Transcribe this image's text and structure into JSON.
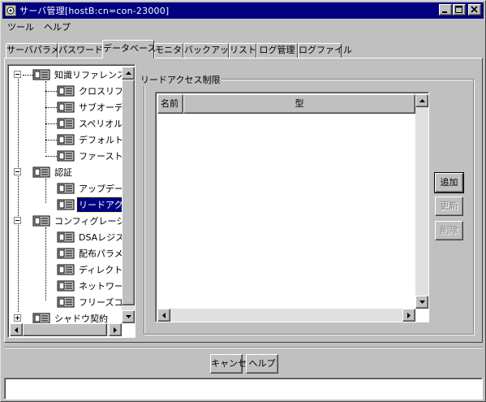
{
  "window": {
    "title": "サーバ管理[hostB:cn=con-23000]",
    "controls": [
      "minimize-icon",
      "maximize-icon",
      "close-icon"
    ]
  },
  "menubar": {
    "items": [
      "ツール",
      "ヘルプ"
    ]
  },
  "tabs": [
    {
      "label": "サーバパラメタ",
      "selected": false
    },
    {
      "label": "パスワード",
      "selected": false
    },
    {
      "label": "データベース",
      "selected": true
    },
    {
      "label": "モニター",
      "selected": false
    },
    {
      "label": "バックアップ",
      "selected": false
    },
    {
      "label": "リストア",
      "selected": false
    },
    {
      "label": "ログ管理",
      "selected": false
    },
    {
      "label": "ログファイル",
      "selected": false
    }
  ],
  "tree": {
    "nodes": [
      {
        "label": "知識リファレンス",
        "level": 0,
        "expander": "−"
      },
      {
        "label": "クロスリファレンス",
        "level": 1
      },
      {
        "label": "サブオーディネートリファレンス",
        "level": 1
      },
      {
        "label": "スペリオルリファレンス",
        "level": 1
      },
      {
        "label": "デフォルトリファレンス",
        "level": 1
      },
      {
        "label": "ファーストレベルリファレンス",
        "level": 1
      },
      {
        "label": "認証",
        "level": 0,
        "expander": "−"
      },
      {
        "label": "アップデートアクセス制限",
        "level": 1
      },
      {
        "label": "リードアクセス制限",
        "level": 1,
        "selected": true
      },
      {
        "label": "コンフィグレーション",
        "level": 0,
        "expander": "−"
      },
      {
        "label": "DSAレジストリ",
        "level": 1
      },
      {
        "label": "配布パラメタ",
        "level": 1
      },
      {
        "label": "ディレクトリコンフィグ",
        "level": 1
      },
      {
        "label": "ネットワークパラメタ",
        "level": 1
      },
      {
        "label": "フリーズコンフィグ",
        "level": 1
      },
      {
        "label": "シャドウ契約",
        "level": 0,
        "expander": "+"
      }
    ]
  },
  "panel": {
    "group_title": "リードアクセス制限",
    "columns": [
      "名前",
      "型"
    ],
    "rows": []
  },
  "side_buttons": {
    "add": "追加",
    "update": "更新",
    "delete": "削除"
  },
  "bottom_buttons": {
    "cancel": "キャンセル",
    "help": "ヘルプ"
  },
  "status": {
    "text": ""
  },
  "colors": {
    "titlebar": "#000080",
    "face": "#c0c0c0",
    "selection": "#000080"
  }
}
